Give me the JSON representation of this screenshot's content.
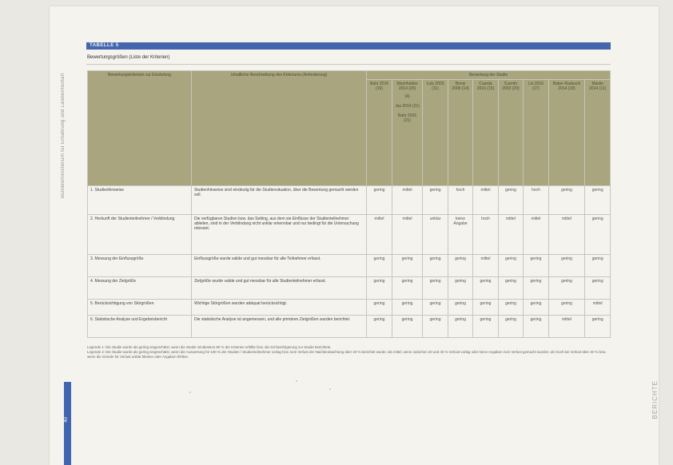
{
  "page": {
    "side_margin_text": "Bundesministerium für Ernährung und Landwirtschaft",
    "right_margin_text": "BERICHTE",
    "page_number": "40"
  },
  "table": {
    "banner_label": "TABELLE 5",
    "caption": "Bewertungsgrößen (Liste der Kriterien)",
    "header": {
      "criterion_col": "Bewertungskriterium zur Einstufung",
      "description_col": "Inhaltliche Beschreibung des Kriteriums (Anforderung)",
      "group_label": "Bewertung der Studie",
      "studies": [
        {
          "label": "Bahr 2016 (16)",
          "extra": ""
        },
        {
          "label": "Wachholder 2014 (20)",
          "extra": "(4)"
        },
        {
          "label": "Lutz 2003 (11)",
          "extra": ""
        },
        {
          "label": "Bonis 2009 (14)",
          "extra": ""
        },
        {
          "label": "Cuarda 2016 (15)",
          "extra": ""
        },
        {
          "label": "Cuerdo 2003 (20)",
          "extra": ""
        },
        {
          "label": "Loi 2016 (17)",
          "extra": ""
        },
        {
          "label": "Baker-Radusch 2014 (18)",
          "extra": ""
        },
        {
          "label": "Maslio 2014 (11)",
          "extra": ""
        }
      ],
      "wach_extra_lines": [
        "Jas 2014 (21)",
        "Bahr 2016 (21)"
      ]
    },
    "rows": [
      {
        "criterion": "1. Studienhinweise",
        "description": "Studienhinweise sind eindeutig für die Studiensituation, über die Bewertung gemacht werden soll.",
        "ratings": [
          "gering",
          "mittel",
          "gering",
          "hoch",
          "mittel",
          "gering",
          "hoch",
          "gering",
          "gering"
        ]
      },
      {
        "criterion": "2. Herkunft der Studienteilnehmer / Verblindung",
        "description": "Die verfügbaren Studien bzw. das Setting, aus dem sie Einflüsse der Studienteilnehmer ableiten, sind in der Verblindung nicht unklar erkennbar und nur bedingt für die Untersuchung relevant.",
        "ratings": [
          "mittel",
          "mittel",
          "unklar",
          "keine Angabe",
          "hoch",
          "mittel",
          "mittel",
          "mittel",
          "gering"
        ]
      },
      {
        "criterion": "3. Messung der Einflussgröße",
        "description": "Einflussgröße wurde valide und gut messbar für alle Teilnehmer erfasst.",
        "ratings": [
          "gering",
          "gering",
          "gering",
          "gering",
          "mittel",
          "gering",
          "gering",
          "gering",
          "gering"
        ]
      },
      {
        "criterion": "4. Messung der Zielgröße",
        "description": "Zielgröße wurde valide und gut messbar für alle Studienteilnehmer erfasst.",
        "ratings": [
          "gering",
          "gering",
          "gering",
          "gering",
          "gering",
          "gering",
          "gering",
          "gering",
          "gering"
        ]
      },
      {
        "criterion": "5. Berücksichtigung von Störgrößen",
        "description": "Wichtige Störgrößen wurden adäquat berücksichtigt.",
        "ratings": [
          "gering",
          "gering",
          "gering",
          "gering",
          "gering",
          "gering",
          "gering",
          "gering",
          "mittel"
        ]
      },
      {
        "criterion": "6. Statistische Analyse und Ergebnisbericht",
        "description": "Die statistische Analyse ist angemessen, und alle primären Zielgrößen wurden berichtet.",
        "ratings": [
          "gering",
          "gering",
          "gering",
          "gering",
          "gering",
          "gering",
          "gering",
          "mittel",
          "gering"
        ]
      }
    ],
    "footnotes": [
      "Legende 1: Die Studie wurde als gering eingeschätzt, wenn die Studie mindestens 80 % der Kriterien erfüllte bzw. die Schlussfolgerung zur Studie berichtete.",
      "Legende 2: Die Studie wurde als gering eingeschätzt, wenn die Auswertung für 100 % der Studien / Studienteilnehmer vorlag bzw. kein Verlust der Nachbeobachtung über 20 % berichtet wurde; als mittel, wenn zwischen 20 und 40 % Verlust vorlag oder keine Angaben zum Verlust gemacht wurden; als hoch bei Verlust über 40 % bzw. wenn die Gründe für Verlust unklar blieben oder Angaben fehlten."
    ]
  }
}
